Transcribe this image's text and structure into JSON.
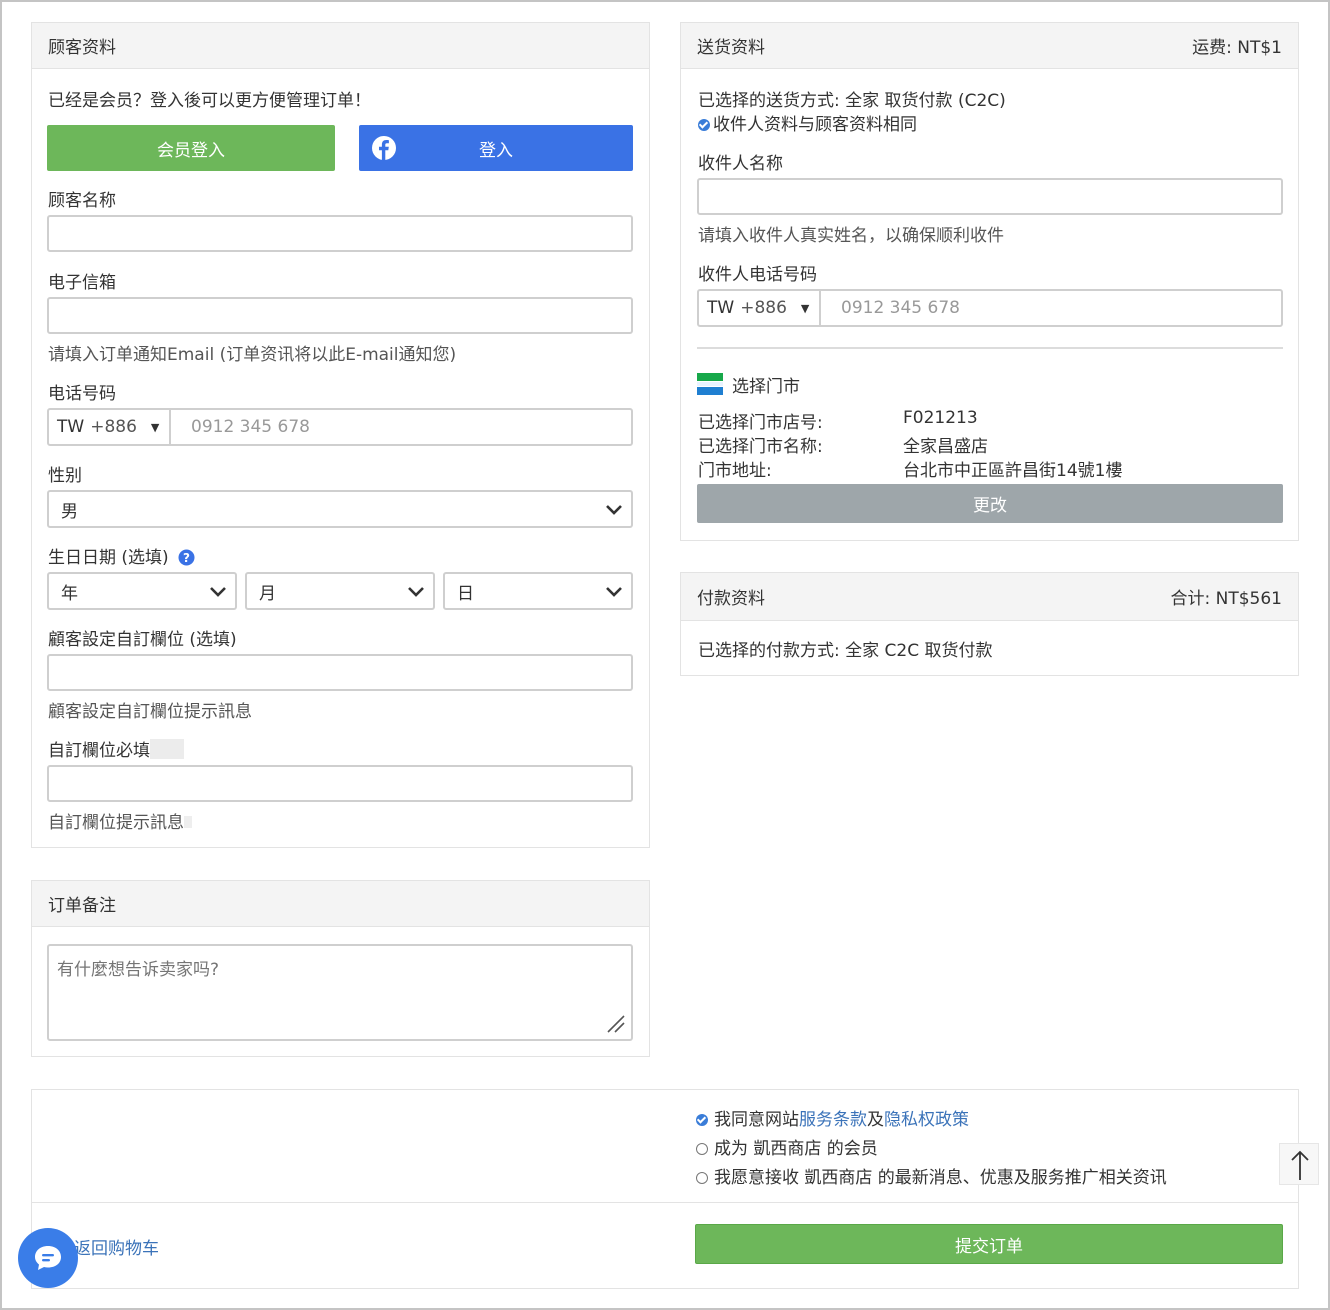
{
  "customer": {
    "title": "顾客资料",
    "member_prompt": "已经是会员？登入後可以更方便管理订单！",
    "member_login_label": "会员登入",
    "fb_login_label": "登入",
    "name_label": "顾客名称",
    "email_label": "电子信箱",
    "email_hint": "请填入订单通知Email (订单资讯将以此E-mail通知您)",
    "phone_label": "电话号码",
    "phone_country": "TW",
    "phone_code": "+886",
    "phone_placeholder": "0912 345 678",
    "gender_label": "性别",
    "gender_value": "男",
    "birthday_label": "生日日期 (选填)",
    "birth_year": "年",
    "birth_month": "月",
    "birth_day": "日",
    "custom1_label": "顧客設定自訂欄位 (选填)",
    "custom1_hint": "顧客設定自訂欄位提示訊息",
    "custom2_label": "自訂欄位必填",
    "custom2_hint": "自訂欄位提示訊息"
  },
  "note": {
    "title": "订单备注",
    "placeholder": "有什麼想告诉卖家吗?"
  },
  "delivery": {
    "title": "送货资料",
    "fee": "运费: NT$1",
    "method": "已选择的送货方式: 全家 取货付款 (C2C)",
    "same_as_customer": "收件人资料与顾客资料相同",
    "recipient_name_label": "收件人名称",
    "recipient_name_hint": "请填入收件人真实姓名，以确保顺利收件",
    "recipient_phone_label": "收件人电话号码",
    "phone_country": "TW",
    "phone_code": "+886",
    "phone_placeholder": "0912 345 678",
    "store_select_label": "选择门市",
    "store_rows": [
      {
        "key": "已选择门市店号:",
        "value": "F021213"
      },
      {
        "key": "已选择门市名称:",
        "value": "全家昌盛店"
      },
      {
        "key": "门市地址:",
        "value": "台北市中正區許昌街14號1樓"
      }
    ],
    "change_label": "更改"
  },
  "payment": {
    "title": "付款资料",
    "total": "合计: NT$561",
    "method": "已选择的付款方式: 全家 C2C 取货付款"
  },
  "footer": {
    "agree_prefix": "我同意网站",
    "terms": "服务条款",
    "and": "及",
    "privacy": "隐私权政策",
    "become_member": "成为 凱西商店 的会员",
    "newsletter": "我愿意接收 凱西商店 的最新消息、优惠及服务推广相关资讯",
    "back_to_cart": "返回购物车",
    "submit": "提交订单"
  },
  "colors": {
    "green": "#6db75a",
    "blue": "#3a72e5",
    "gray_btn": "#9ea6aa",
    "link": "#3b73b9"
  }
}
